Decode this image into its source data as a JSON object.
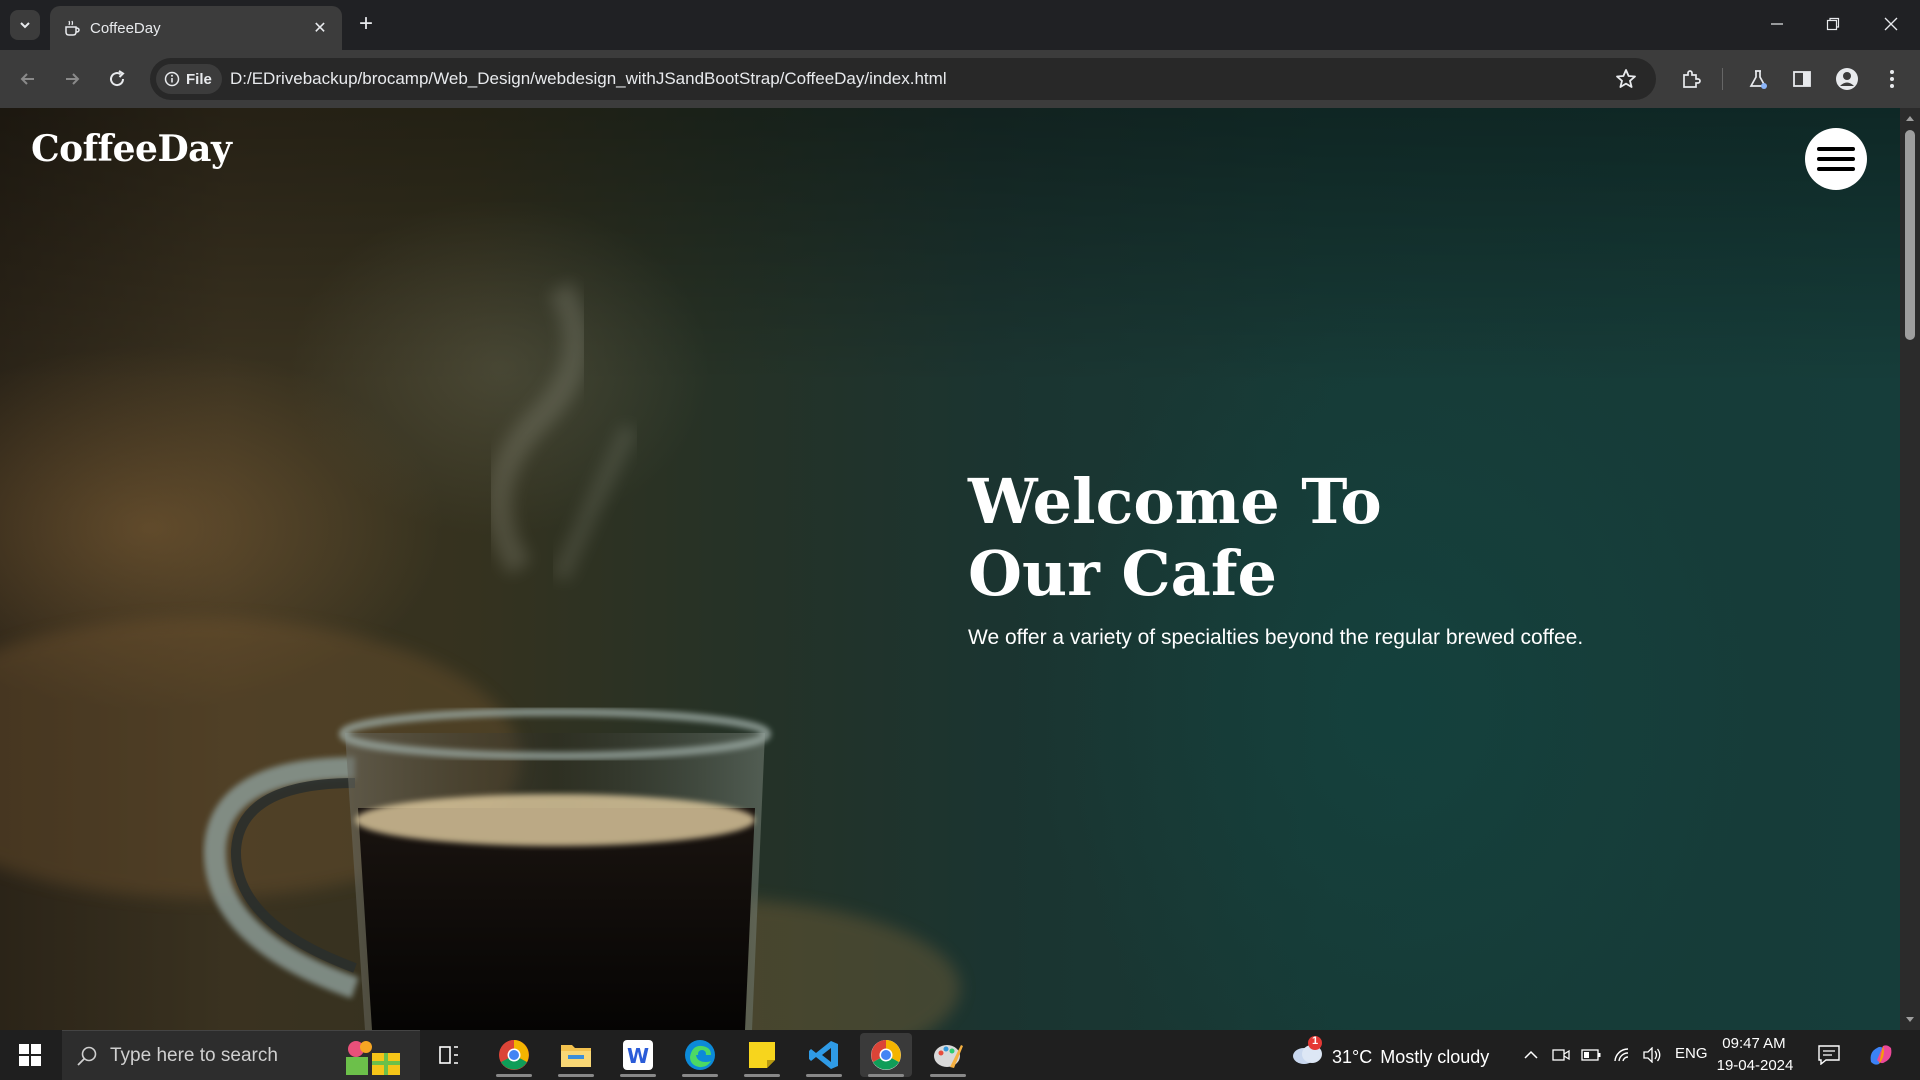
{
  "browser": {
    "tab_title": "CoffeeDay",
    "url_scheme_label": "File",
    "url": "D:/EDrivebackup/brocamp/Web_Design/webdesign_withJSandBootStrap/CoffeeDay/index.html"
  },
  "page": {
    "brand": "CoffeeDay",
    "hero_title_line1": "Welcome To",
    "hero_title_line2": "Our Cafe",
    "hero_subtitle": "We offer a variety of specialties beyond the regular brewed coffee."
  },
  "taskbar": {
    "search_placeholder": "Type here to search",
    "weather_temp": "31°C",
    "weather_text": "Mostly cloudy",
    "weather_alert_count": "1",
    "language": "ENG",
    "time": "09:47 AM",
    "date": "19-04-2024"
  },
  "icons": {
    "tab_favicon": "coffee-cup-icon",
    "apps": [
      "chrome-icon",
      "file-explorer-icon",
      "word-icon",
      "edge-icon",
      "sticky-notes-icon",
      "vscode-icon",
      "chrome-dev-icon",
      "paint-icon"
    ]
  },
  "colors": {
    "page_accent": "#173a36",
    "chrome_dark": "#202124",
    "toolbar": "#3c3c3c"
  }
}
